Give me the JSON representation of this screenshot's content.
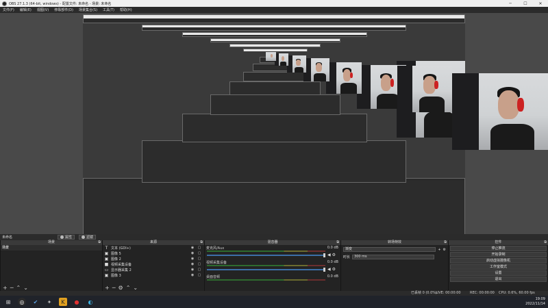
{
  "window": {
    "title": "OBS 27.1.3 (64-bit, windows) - 配置文件: 未命名 - 场景: 未命名",
    "minimize": "─",
    "maximize": "☐",
    "close": "✕"
  },
  "menu": [
    "文件(F)",
    "编辑(E)",
    "视图(V)",
    "停靠部件(D)",
    "场景集合(S)",
    "工具(T)",
    "帮助(H)"
  ],
  "dock_strip": {
    "scene_label": "未命名",
    "filters_button": "属性",
    "filters2_button": "滤镜"
  },
  "scenes": {
    "title": "场景",
    "items": [
      "场景"
    ]
  },
  "sources": {
    "title": "来源",
    "items": [
      {
        "name": "文本 (GDI+)",
        "icon": "T"
      },
      {
        "name": "图像 5",
        "icon": "▣"
      },
      {
        "name": "图像 2",
        "icon": "▣"
      },
      {
        "name": "视频采集设备",
        "icon": "■"
      },
      {
        "name": "显示器采集 2",
        "icon": "▭"
      },
      {
        "name": "图像 3",
        "icon": "▣"
      }
    ]
  },
  "mixer": {
    "title": "混音器",
    "channels": [
      {
        "name": "麦克风/Aux",
        "db": "0.0 dB"
      },
      {
        "name": "视频采集设备",
        "db": "0.0 dB"
      },
      {
        "name": "桌面音频",
        "db": "0.0 dB"
      }
    ]
  },
  "transitions": {
    "title": "转场特效",
    "selected": "渐变",
    "duration_label": "时长",
    "duration_value": "300 ms"
  },
  "controls": {
    "title": "控件",
    "buttons": [
      "停止推流",
      "开始录制",
      "启动虚拟摄像机",
      "工作室模式",
      "设置",
      "退出"
    ]
  },
  "status": {
    "dropped": "已丢帧 0 (0.0%)",
    "live": "LIVE: 00:00:00",
    "rec": "REC: 00:00:00",
    "cpu": "CPU: 0.6%, 60.00 fps"
  },
  "taskbar": {
    "time": "19:09",
    "date": "2022/11/14"
  }
}
